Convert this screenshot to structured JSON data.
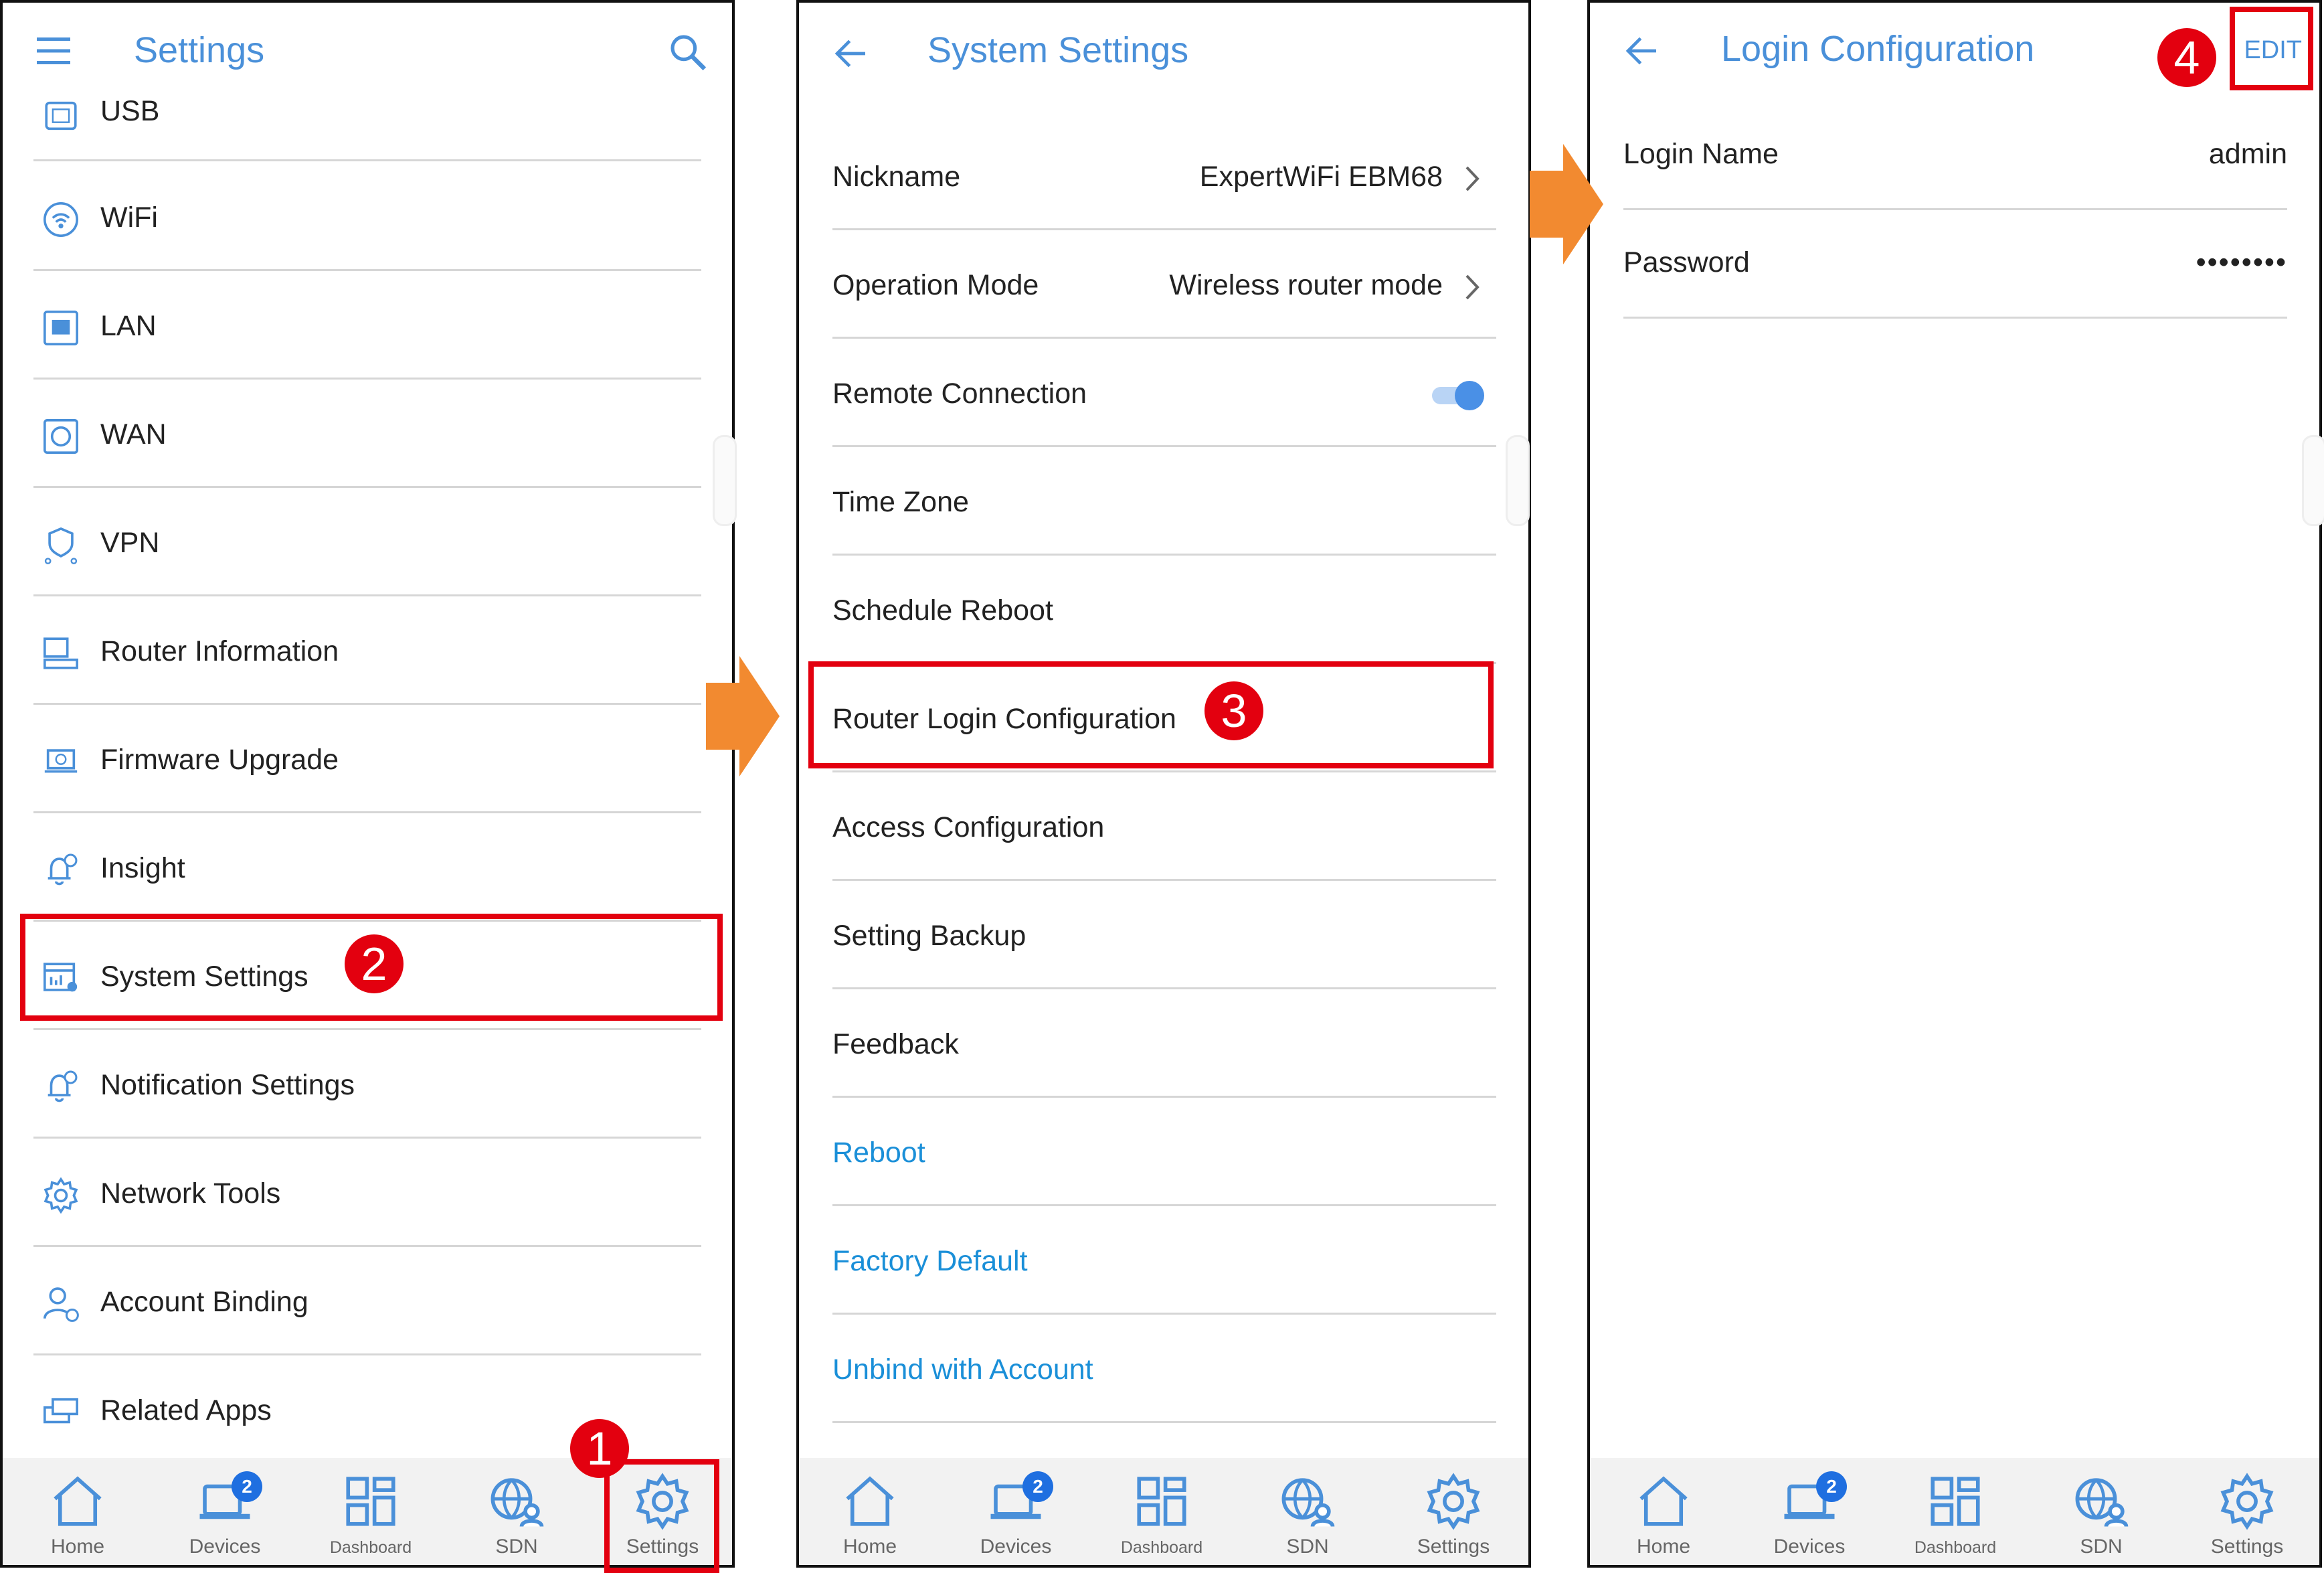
{
  "panel1": {
    "title": "Settings",
    "items": [
      {
        "label": "USB",
        "icon": "usb-icon"
      },
      {
        "label": "WiFi",
        "icon": "wifi-icon"
      },
      {
        "label": "LAN",
        "icon": "lan-icon"
      },
      {
        "label": "WAN",
        "icon": "wan-icon"
      },
      {
        "label": "VPN",
        "icon": "vpn-icon"
      },
      {
        "label": "Router Information",
        "icon": "router-icon"
      },
      {
        "label": "Firmware Upgrade",
        "icon": "firmware-icon"
      },
      {
        "label": "Insight",
        "icon": "bell-icon"
      },
      {
        "label": "System Settings",
        "icon": "system-settings-icon"
      },
      {
        "label": "Notification Settings",
        "icon": "notification-bell-icon"
      },
      {
        "label": "Network Tools",
        "icon": "tools-gear-icon"
      },
      {
        "label": "Account Binding",
        "icon": "account-icon"
      },
      {
        "label": "Related Apps",
        "icon": "apps-icon"
      }
    ]
  },
  "panel2": {
    "title": "System Settings",
    "items": [
      {
        "label": "Nickname",
        "value": "ExpertWiFi EBM68"
      },
      {
        "label": "Operation Mode",
        "value": "Wireless router mode"
      },
      {
        "label": "Remote Connection",
        "toggle_on": true
      },
      {
        "label": "Time Zone"
      },
      {
        "label": "Schedule Reboot"
      },
      {
        "label": "Router Login Configuration"
      },
      {
        "label": "Access Configuration"
      },
      {
        "label": "Setting Backup"
      },
      {
        "label": "Feedback"
      },
      {
        "label": "Reboot"
      },
      {
        "label": "Factory Default"
      },
      {
        "label": "Unbind with Account"
      }
    ]
  },
  "panel3": {
    "title": "Login Configuration",
    "edit_label": "EDIT",
    "items": [
      {
        "label": "Login Name",
        "value": "admin"
      },
      {
        "label": "Password",
        "value": "••••••••"
      }
    ]
  },
  "nav": {
    "home": "Home",
    "devices": "Devices",
    "devices_badge": "2",
    "dashboard": "Dashboard",
    "sdn": "SDN",
    "settings": "Settings"
  },
  "steps": [
    "1",
    "2",
    "3",
    "4"
  ],
  "colors": {
    "accent": "#4a90d9",
    "link": "#1a8fd8",
    "highlight": "#e3000f",
    "arrow": "#f28a30",
    "badge": "#1f6fe0"
  }
}
